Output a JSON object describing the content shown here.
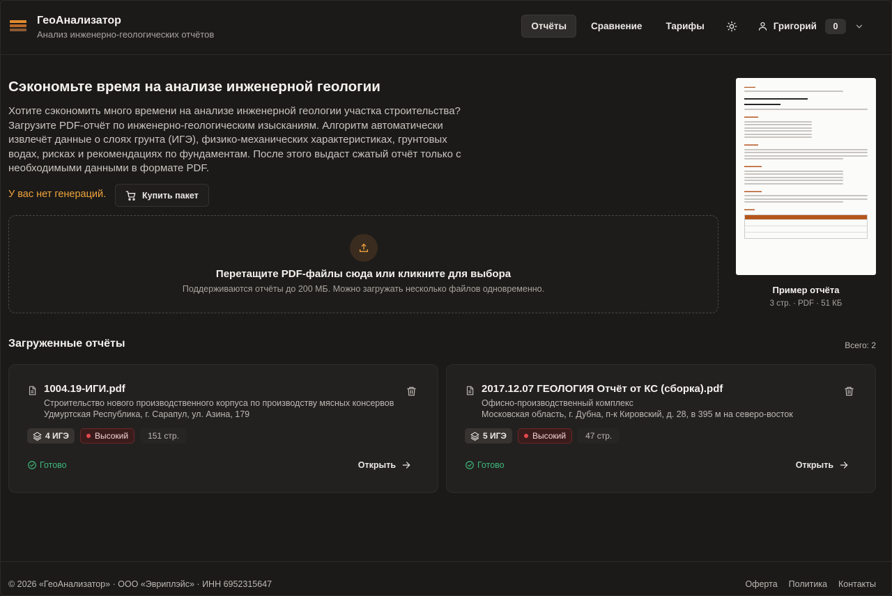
{
  "app": {
    "title": "ГеоАнализатор",
    "subtitle": "Анализ инженерно-геологических отчётов"
  },
  "nav": {
    "items": [
      {
        "label": "Отчёты",
        "active": true
      },
      {
        "label": "Сравнение",
        "active": false
      },
      {
        "label": "Тарифы",
        "active": false
      }
    ],
    "theme_icon": "sun-icon",
    "user_name": "Григорий",
    "credits": "0"
  },
  "hero": {
    "title": "Сэкономьте время на анализе инженерной геологии",
    "text": "Хотите сэкономить много времени на анализе инженерной геологии участка строительства? Загрузите PDF-отчёт по инженерно-геологическим изысканиям. Алгоритм автоматически извлечёт данные о слоях грунта (ИГЭ), физико-механических характеристиках, грунтовых водах, рисках и рекомендациях по фундаментам. После этого выдаст сжатый отчёт только с необходимыми данными в формате PDF.",
    "no_generations": "У вас нет генераций.",
    "buy_label": "Купить пакет"
  },
  "dropzone": {
    "title": "Перетащите PDF-файлы сюда или кликните для выбора",
    "subtitle": "Поддерживаются отчёты до 200 МБ. Можно загружать несколько файлов одновременно."
  },
  "sample": {
    "title": "Пример отчёта",
    "meta": "3 стр. · PDF · 51 КБ"
  },
  "uploaded": {
    "title": "Загруженные отчёты",
    "total": "Всего: 2",
    "reports": [
      {
        "file_name": "1004.19-ИГИ.pdf",
        "description": "Строительство нового производственного корпуса по производству мясных консервов",
        "address": "Удмуртская Республика, г. Сарапул, ул. Азина, 179",
        "ige": "4 ИГЭ",
        "risk": "Высокий",
        "pages": "151 стр.",
        "status": "Готово",
        "open_label": "Открыть"
      },
      {
        "file_name": "2017.12.07 ГЕОЛОГИЯ Отчёт от КС (сборка).pdf",
        "description": "Офисно-производственный комплекс",
        "address": "Московская область, г. Дубна, п-к Кировский, д. 28, в 395 м на северо-восток",
        "ige": "5 ИГЭ",
        "risk": "Высокий",
        "pages": "47 стр.",
        "status": "Готово",
        "open_label": "Открыть"
      }
    ]
  },
  "colors": {
    "accent": "#f0a33a",
    "success": "#3fb87a",
    "danger": "#e5484d"
  },
  "footer": {
    "copyright": "© 2026 «ГеоАнализатор» · ООО «Эвриплэйс» · ИНН 6952315647",
    "links": [
      "Оферта",
      "Политика",
      "Контакты"
    ]
  }
}
